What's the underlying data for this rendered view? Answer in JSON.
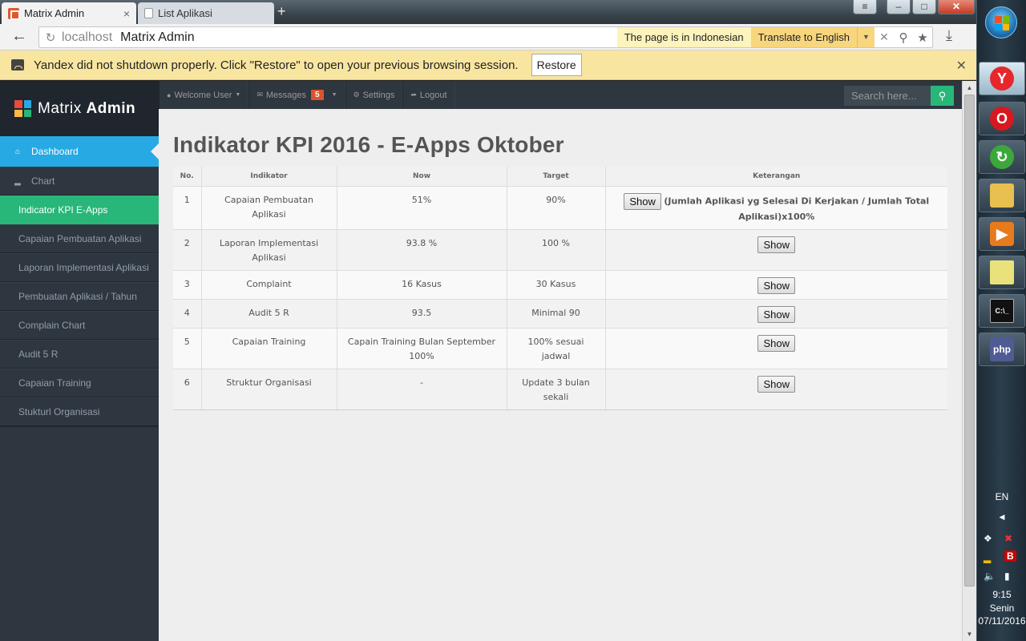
{
  "browser": {
    "tabs": [
      {
        "label": "Matrix Admin",
        "close": "×"
      },
      {
        "label": "List Aplikasi"
      }
    ],
    "new_tab": "+",
    "window_buttons": {
      "menu": "≡",
      "minimize": "–",
      "maximize": "□",
      "close": "✕"
    },
    "address": {
      "host": "localhost",
      "title": "Matrix Admin"
    },
    "translate": {
      "label": "The page is in Indonesian",
      "button": "Translate to English"
    },
    "infobar": {
      "message": "Yandex did not shutdown properly. Click \"Restore\" to open your previous browsing session.",
      "button": "Restore"
    }
  },
  "app": {
    "logo_light": "Matrix",
    "logo_bold": "Admin",
    "topnav": [
      {
        "label": "Welcome User"
      },
      {
        "label": "Messages",
        "badge": "5"
      },
      {
        "label": "Settings"
      },
      {
        "label": "Logout"
      }
    ],
    "search": {
      "placeholder": "Search here..."
    },
    "sidebar": [
      {
        "label": "Dashboard"
      },
      {
        "label": "Chart"
      },
      {
        "label": "Indicator KPI E-Apps"
      },
      {
        "label": "Capaian Pembuatan Aplikasi"
      },
      {
        "label": "Laporan Implementasi Aplikasi"
      },
      {
        "label": "Pembuatan Aplikasi / Tahun"
      },
      {
        "label": "Complain Chart"
      },
      {
        "label": "Audit 5 R"
      },
      {
        "label": "Capaian Training"
      },
      {
        "label": "Stukturl Organisasi"
      }
    ],
    "page_title": "Indikator KPI 2016 - E-Apps Oktober",
    "table": {
      "headers": [
        "No.",
        "Indikator",
        "Now",
        "Target",
        "Keterangan"
      ],
      "rows": [
        {
          "no": "1",
          "indikator": "Capaian Pembuatan Aplikasi",
          "now": "51%",
          "target": "90%",
          "button": "Show",
          "note": "(Jumlah Aplikasi yg Selesai Di Kerjakan / Jumlah Total Aplikasi)x100%"
        },
        {
          "no": "2",
          "indikator": "Laporan Implementasi Aplikasi",
          "now": "93.8 %",
          "target": "100 %",
          "button": "Show"
        },
        {
          "no": "3",
          "indikator": "Complaint",
          "now": "16 Kasus",
          "target": "30 Kasus",
          "button": "Show"
        },
        {
          "no": "4",
          "indikator": "Audit 5 R",
          "now": "93.5",
          "target": "Minimal 90",
          "button": "Show"
        },
        {
          "no": "5",
          "indikator": "Capaian Training",
          "now": "Capain Training Bulan September 100%",
          "target": "100% sesuai jadwal",
          "button": "Show"
        },
        {
          "no": "6",
          "indikator": "Struktur Organisasi",
          "now": "-",
          "target": "Update 3 bulan sekali",
          "button": "Show"
        }
      ]
    }
  },
  "taskbar": {
    "language": "EN",
    "time": "9:15",
    "day": "Senin",
    "date": "07/11/2016"
  }
}
